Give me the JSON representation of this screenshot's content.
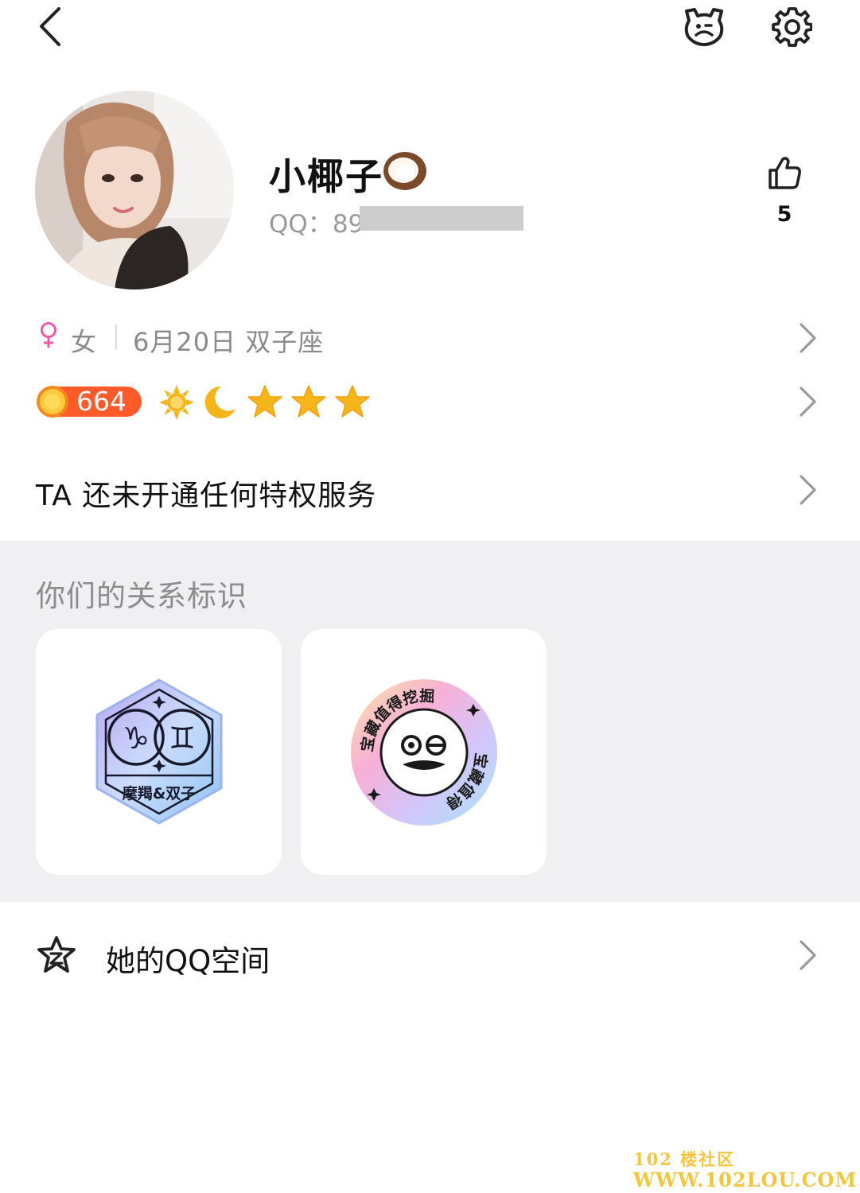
{
  "header": {
    "back_icon": "back-arrow-icon",
    "pet_icon": "bear-face-icon",
    "settings_icon": "gear-icon"
  },
  "profile": {
    "name": "小椰子",
    "name_emoji": "coconut-icon",
    "qq_label": "QQ：",
    "qq_visible": "89",
    "likes": "5"
  },
  "info": {
    "gender_symbol": "♀",
    "gender": "女",
    "birthday": "6月20日 双子座"
  },
  "level": {
    "value": "664",
    "icons": [
      "sun-icon",
      "moon-icon",
      "star-icon",
      "star-icon",
      "star-icon"
    ]
  },
  "privilege": {
    "text": "TA 还未开通任何特权服务"
  },
  "relationship": {
    "title": "你们的关系标识",
    "cards": [
      {
        "icon": "zodiac-badge-icon",
        "label": "摩羯&双子"
      },
      {
        "icon": "treasure-badge-icon",
        "ring_text_top": "宝藏值得挖掘",
        "ring_text_bottom": "宝藏值得挖掘"
      }
    ]
  },
  "qzone": {
    "label": "她的QQ空间",
    "icon": "qzone-star-icon"
  },
  "watermark": {
    "line1": "102 楼社区",
    "line2": "WWW.102LOU.COM"
  },
  "colors": {
    "accent_orange": "#ff5a2a",
    "gold": "#f7b51c",
    "female_pink": "#f25aa5",
    "section_bg": "#f0f0f2"
  }
}
